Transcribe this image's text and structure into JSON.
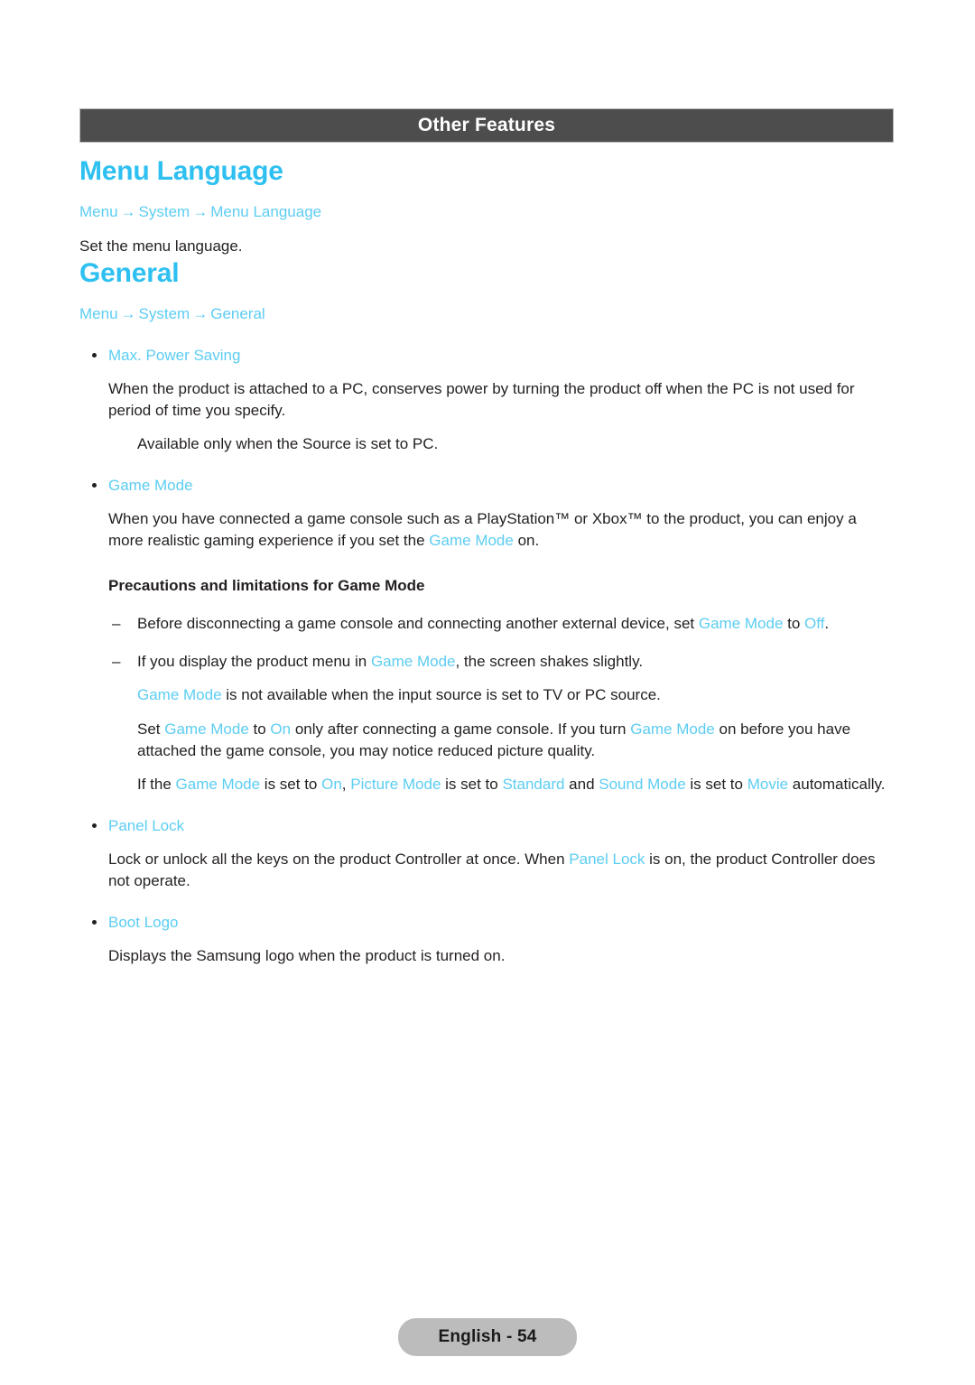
{
  "header": {
    "section_title": "Other Features"
  },
  "sections": [
    {
      "heading": "Menu Language",
      "breadcrumb": [
        "Menu",
        "System",
        "Menu Language"
      ],
      "breadcrumb_arrow": "→",
      "description": "Set the menu language."
    },
    {
      "heading": "General",
      "breadcrumb": [
        "Menu",
        "System",
        "General"
      ],
      "breadcrumb_arrow": "→"
    }
  ],
  "general": {
    "items": [
      {
        "label": "Max. Power Saving",
        "body": "When the product is attached to a PC, conserves power by turning the product off when the PC is not used for period of time you specify.",
        "note": "Available only when the Source is set to PC."
      },
      {
        "label": "Game Mode",
        "body_pre": "When you have connected a game console such as a PlayStation™ or Xbox™ to the product, you can enjoy a more realistic gaming experience if you set the ",
        "body_term": "Game Mode",
        "body_post": " on.",
        "subhead": "Precautions and limitations for Game Mode",
        "dash_items": [
          {
            "pre": "Before disconnecting a game console and connecting another external device, set ",
            "term1": "Game Mode",
            "mid": " to ",
            "term2": "Off",
            "post": "."
          },
          {
            "pre": "If you display the product menu in ",
            "term1": "Game Mode",
            "mid": ", the screen shakes slightly.",
            "term2": "",
            "post": ""
          }
        ],
        "note_line": {
          "term1": "Game Mode",
          "post": " is not available when the input source is set to TV or PC source."
        },
        "para_on": {
          "p1": "Set ",
          "t1": "Game Mode",
          "p2": " to ",
          "t2": "On",
          "p3": " only after connecting a game console. If you turn ",
          "t3": "Game Mode",
          "p4": " on before you have attached the game console, you may notice reduced picture quality."
        },
        "para_auto": {
          "p1": "If the ",
          "t1": "Game Mode",
          "p2": " is set to ",
          "t2": "On",
          "p3": ", ",
          "t3": "Picture Mode",
          "p4": " is set to ",
          "t4": "Standard",
          "p5": " and ",
          "t5": "Sound Mode",
          "p6": " is set to ",
          "t6": "Movie",
          "p7": " automatically."
        }
      },
      {
        "label": "Panel Lock",
        "body_pre": "Lock or unlock all the keys on the product Controller at once. When ",
        "body_term": "Panel Lock",
        "body_post": " is on, the product Controller does not operate."
      },
      {
        "label": "Boot Logo",
        "body": "Displays the Samsung logo when the product is turned on."
      }
    ]
  },
  "footer": {
    "page_label": "English - 54"
  },
  "colors": {
    "accent_heading": "#2ec0f0",
    "accent_text": "#5ccdf2",
    "bar_background": "#4d4d4d",
    "body_text": "#231f20",
    "footer_pill": "#bcbcbc"
  }
}
